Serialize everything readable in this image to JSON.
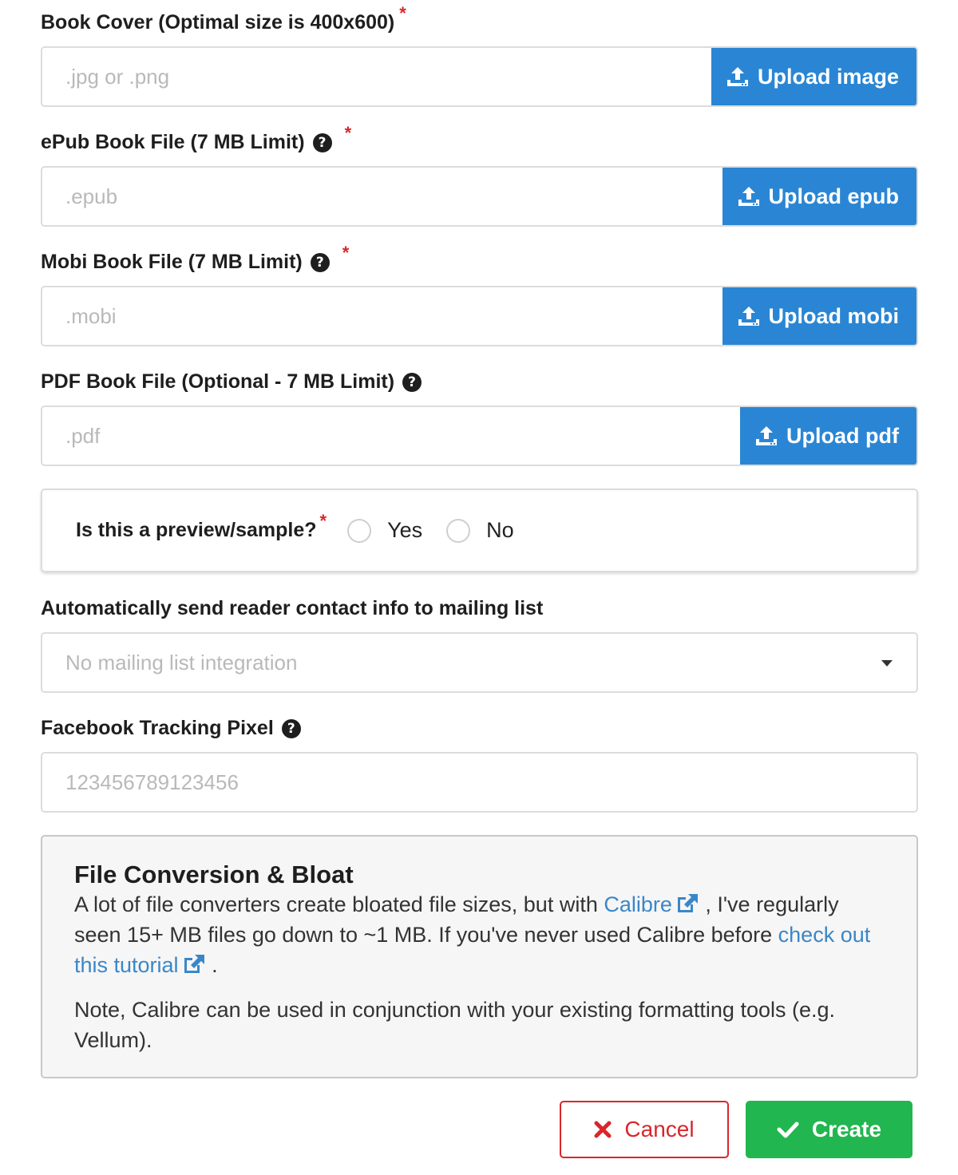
{
  "cover": {
    "label": "Book Cover (Optimal size is 400x600)",
    "required_mark": "*",
    "placeholder": ".jpg or .png",
    "button_label": "Upload image"
  },
  "epub": {
    "label": "ePub Book File (7 MB Limit)",
    "required_mark": "*",
    "help_glyph": "?",
    "placeholder": ".epub",
    "button_label": "Upload epub"
  },
  "mobi": {
    "label": "Mobi Book File (7 MB Limit)",
    "required_mark": "*",
    "help_glyph": "?",
    "placeholder": ".mobi",
    "button_label": "Upload mobi"
  },
  "pdf": {
    "label": "PDF Book File (Optional - 7 MB Limit)",
    "help_glyph": "?",
    "placeholder": ".pdf",
    "button_label": "Upload pdf"
  },
  "preview": {
    "question": "Is this a preview/sample?",
    "required_mark": "*",
    "options": [
      {
        "label": "Yes",
        "selected": false
      },
      {
        "label": "No",
        "selected": false
      }
    ]
  },
  "mailing": {
    "label": "Automatically send reader contact info to mailing list",
    "selected_value": "No mailing list integration"
  },
  "pixel": {
    "label": "Facebook Tracking Pixel",
    "help_glyph": "?",
    "placeholder": "123456789123456"
  },
  "info_box": {
    "title": "File Conversion & Bloat",
    "p1_before": "A lot of file converters create bloated file sizes, but with ",
    "link1": "Calibre",
    "p1_middle": " , I've regularly seen 15+ MB files go down to ~1 MB. If you've never used Calibre before ",
    "link2": "check out this tutorial",
    "p1_end": " .",
    "note": "Note, Calibre can be used in conjunction with your existing formatting tools (e.g. Vellum)."
  },
  "actions": {
    "cancel_label": "Cancel",
    "create_label": "Create"
  },
  "colors": {
    "upload_blue": "#2a86d4",
    "required_red": "#d9262b",
    "create_green": "#21b64f",
    "link_blue": "#3a87c8"
  },
  "icons": {
    "upload": "upload-icon",
    "help": "question-circle-icon",
    "external": "external-link-icon",
    "cancel": "times-icon",
    "create": "check-icon",
    "dropdown": "caret-down-icon"
  }
}
